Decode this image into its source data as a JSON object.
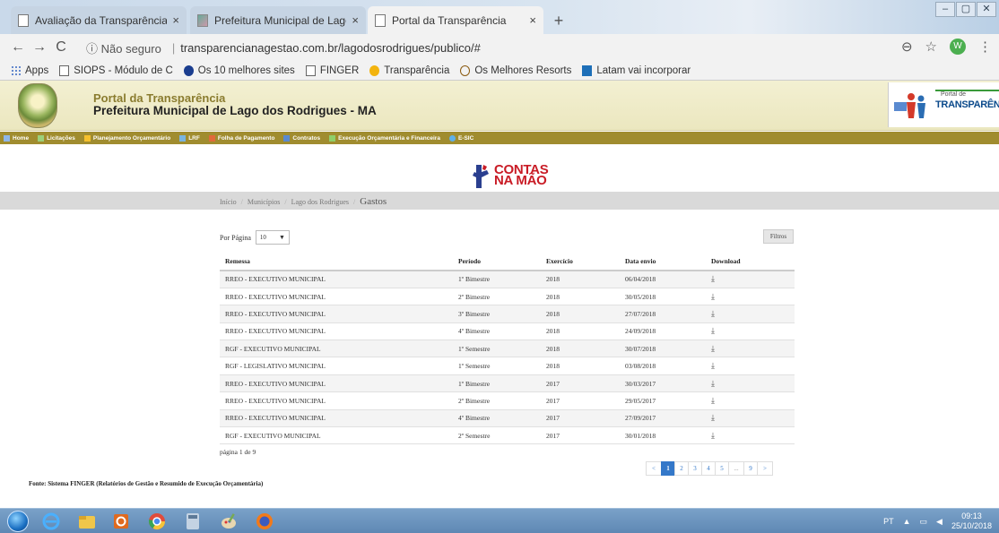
{
  "browser": {
    "tabs": [
      {
        "title": "Avaliação da Transparência dos I",
        "active": false,
        "icon": "page-icon"
      },
      {
        "title": "Prefeitura Municipal de Lago dos",
        "active": false,
        "icon": "photo-icon"
      },
      {
        "title": "Portal da Transparência",
        "active": true,
        "icon": "page-icon"
      }
    ],
    "new_tab_label": "+",
    "close_glyph": "×",
    "window_controls": {
      "minimize": "–",
      "restore": "▢",
      "close": "✕"
    },
    "address": {
      "security_label": "ⓘ Não seguro",
      "separator": "|",
      "url": "transparencianagestao.com.br/lagodosrodrigues/publico/#"
    },
    "nav": {
      "back": "←",
      "forward": "→",
      "reload": "C"
    },
    "right_icons": {
      "zoom": "⊖",
      "star": "☆",
      "avatar_letter": "W",
      "menu": "⋮"
    },
    "bookmarks": [
      {
        "label": "Apps",
        "icon": "dots"
      },
      {
        "label": "SIOPS - Módulo de C",
        "icon": "page"
      },
      {
        "label": "Os 10 melhores sites",
        "icon": "circle"
      },
      {
        "label": "FINGER",
        "icon": "page"
      },
      {
        "label": "Transparência",
        "icon": "yellow"
      },
      {
        "label": "Os Melhores Resorts",
        "icon": "brown"
      },
      {
        "label": "Latam vai incorporar",
        "icon": "blue"
      }
    ]
  },
  "header": {
    "title": "Portal da Transparência",
    "subtitle": "Prefeitura Municipal de Lago dos Rodrigues - MA",
    "logo_small": "Portal de",
    "logo_big": "TRANSPARÊNCI"
  },
  "menu": [
    {
      "label": "Home"
    },
    {
      "label": "Licitações"
    },
    {
      "label": "Planejamento Orçamentário"
    },
    {
      "label": "LRF"
    },
    {
      "label": "Folha de Pagamento"
    },
    {
      "label": "Contratos"
    },
    {
      "label": "Execução Orçamentária e Financeira"
    },
    {
      "label": "E-SIC"
    }
  ],
  "contas": {
    "line1": "CONTAS",
    "line2": "NA MÃO"
  },
  "breadcrumb": {
    "items": [
      "Início",
      "Municípios",
      "Lago dos Rodrigues"
    ],
    "current": "Gastos",
    "separator": "/"
  },
  "controls": {
    "per_page_label": "Por Página",
    "per_page_value": "10",
    "filter_label": "Filtros"
  },
  "table": {
    "headers": [
      "Remessa",
      "Período",
      "Exercício",
      "Data envio",
      "Download"
    ],
    "rows": [
      [
        "RREO - EXECUTIVO MUNICIPAL",
        "1º Bimestre",
        "2018",
        "06/04/2018"
      ],
      [
        "RREO - EXECUTIVO MUNICIPAL",
        "2º Bimestre",
        "2018",
        "30/05/2018"
      ],
      [
        "RREO - EXECUTIVO MUNICIPAL",
        "3º Bimestre",
        "2018",
        "27/07/2018"
      ],
      [
        "RREO - EXECUTIVO MUNICIPAL",
        "4º Bimestre",
        "2018",
        "24/09/2018"
      ],
      [
        "RGF - EXECUTIVO MUNICIPAL",
        "1º Semestre",
        "2018",
        "30/07/2018"
      ],
      [
        "RGF - LEGISLATIVO MUNICIPAL",
        "1º Semestre",
        "2018",
        "03/08/2018"
      ],
      [
        "RREO - EXECUTIVO MUNICIPAL",
        "1º Bimestre",
        "2017",
        "30/03/2017"
      ],
      [
        "RREO - EXECUTIVO MUNICIPAL",
        "2º Bimestre",
        "2017",
        "29/05/2017"
      ],
      [
        "RREO - EXECUTIVO MUNICIPAL",
        "4º Bimestre",
        "2017",
        "27/09/2017"
      ],
      [
        "RGF - EXECUTIVO MUNICIPAL",
        "2º Semestre",
        "2017",
        "30/01/2018"
      ]
    ],
    "download_glyph": "⤓"
  },
  "pagination": {
    "info": "página 1 de 9",
    "items": [
      "<",
      "1",
      "2",
      "3",
      "4",
      "5",
      "...",
      "9",
      ">"
    ],
    "active": "1"
  },
  "footer": {
    "source": "Fonte: Sistema FINGER (Relatórios de Gestão e Resumido de Execução Orçamentária)"
  },
  "taskbar": {
    "lang": "PT",
    "time": "09:13",
    "date": "25/10/2018"
  },
  "colors": {
    "menu_bg": "#a08c2f",
    "header_bg": "#ebe7bf",
    "accent_red": "#c91c26",
    "pager_active": "#3478c9"
  }
}
